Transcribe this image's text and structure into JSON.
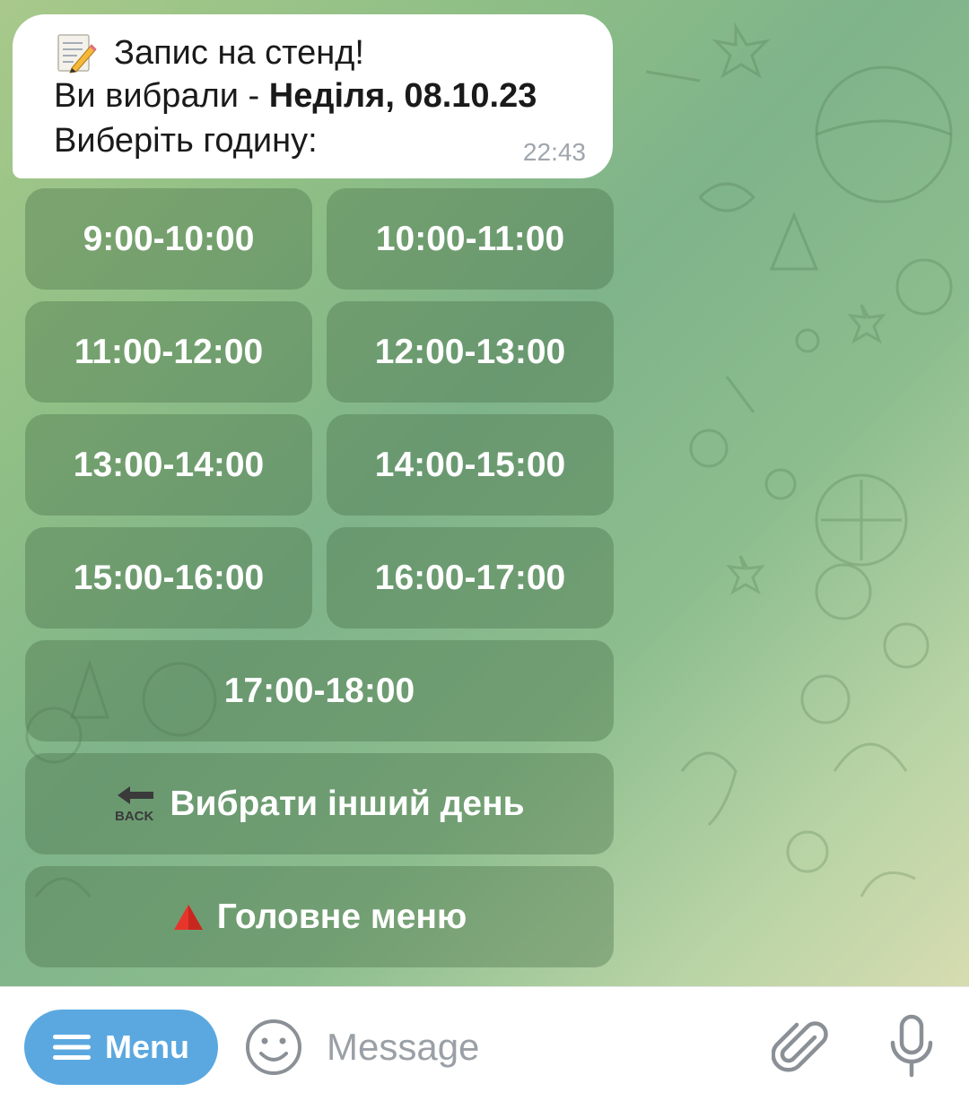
{
  "message": {
    "line1": "Запис на стенд!",
    "line2_prefix": "Ви вибрали - ",
    "line2_bold": "Неділя, 08.10.23",
    "line3": "Виберіть годину:",
    "time": "22:43",
    "icon": "memo-icon"
  },
  "keyboard": {
    "slots": [
      "9:00-10:00",
      "10:00-11:00",
      "11:00-12:00",
      "12:00-13:00",
      "13:00-14:00",
      "14:00-15:00",
      "15:00-16:00",
      "16:00-17:00",
      "17:00-18:00"
    ],
    "back_label": "Вибрати інший день",
    "back_icon_text": "BACK",
    "main_menu_label": "Головне меню",
    "main_menu_icon": "red-triangle-icon"
  },
  "input_bar": {
    "menu_label": "Menu",
    "placeholder": "Message"
  },
  "colors": {
    "menu_button": "#5ba8e0",
    "button_bg": "rgba(70,110,70,0.38)"
  }
}
